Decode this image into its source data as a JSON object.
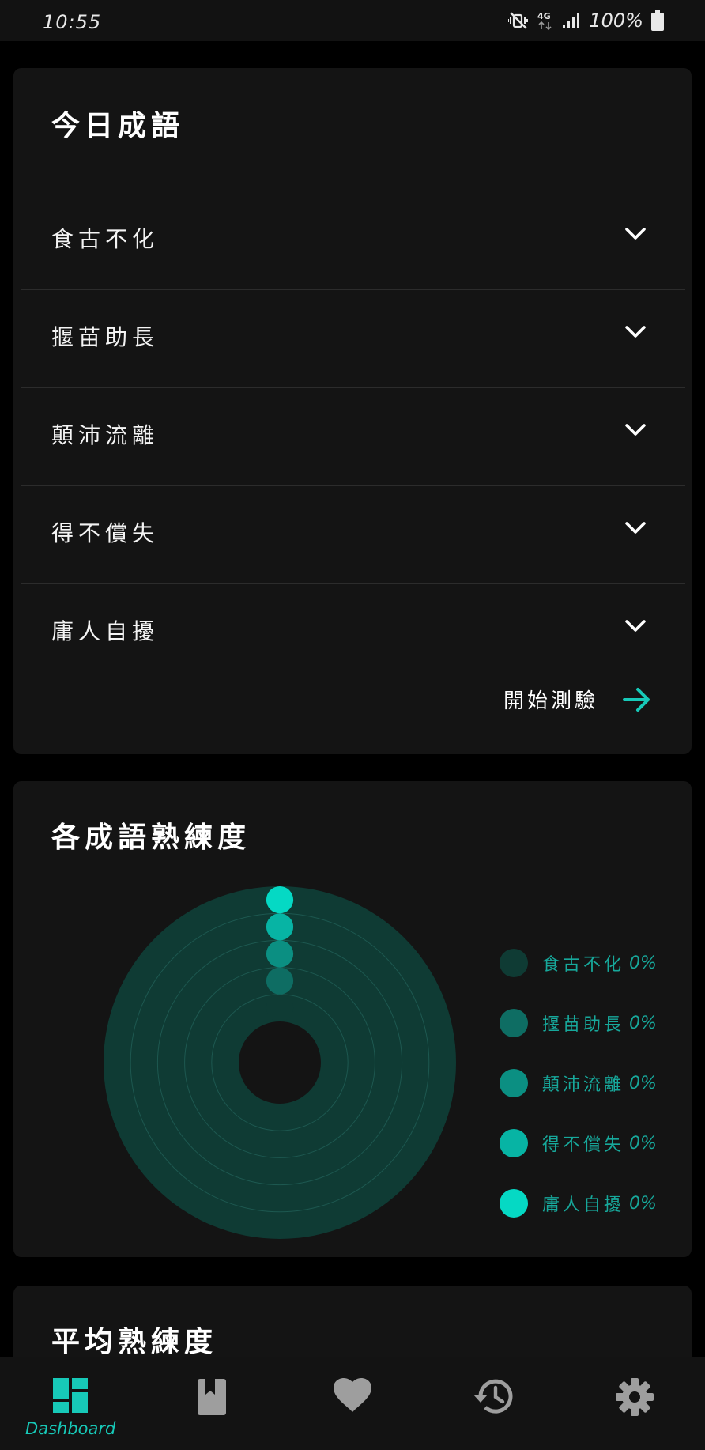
{
  "status_bar": {
    "time": "10:55",
    "network": "4G",
    "battery": "100%",
    "icons": [
      "mute-vibrate-icon",
      "network-4g-icon",
      "signal-icon",
      "battery-icon"
    ]
  },
  "today_card": {
    "title": "今日成語",
    "idioms": [
      {
        "label": "食古不化",
        "icon": "chevron-down-icon"
      },
      {
        "label": "揠苗助長",
        "icon": "chevron-down-icon"
      },
      {
        "label": "顛沛流離",
        "icon": "chevron-down-icon"
      },
      {
        "label": "得不償失",
        "icon": "chevron-down-icon"
      },
      {
        "label": "庸人自擾",
        "icon": "chevron-down-icon"
      }
    ],
    "quiz_label": "開始測驗",
    "quiz_icon": "arrow-right-icon"
  },
  "proficiency_card": {
    "title": "各成語熟練度",
    "chart_data": {
      "type": "radial-progress",
      "series": [
        {
          "name": "食古不化",
          "value": 0,
          "unit": "%",
          "color": "#0f3b34"
        },
        {
          "name": "揠苗助長",
          "value": 0,
          "unit": "%",
          "color": "#0e6d63"
        },
        {
          "name": "顛沛流離",
          "value": 0,
          "unit": "%",
          "color": "#0b8f82"
        },
        {
          "name": "得不償失",
          "value": 0,
          "unit": "%",
          "color": "#07b4a4"
        },
        {
          "name": "庸人自擾",
          "value": 0,
          "unit": "%",
          "color": "#05d9c4"
        }
      ],
      "track_color": "#0f3b34",
      "value_labels": [
        "0%",
        "0%",
        "0%",
        "0%",
        "0%"
      ]
    }
  },
  "average_card": {
    "title": "平均熟練度"
  },
  "bottom_nav": {
    "items": [
      {
        "label": "Dashboard",
        "icon": "dashboard-icon",
        "active": true
      },
      {
        "label": "",
        "icon": "book-icon",
        "active": false
      },
      {
        "label": "",
        "icon": "heart-icon",
        "active": false
      },
      {
        "label": "",
        "icon": "history-icon",
        "active": false
      },
      {
        "label": "",
        "icon": "settings-icon",
        "active": false
      }
    ]
  },
  "colors": {
    "accent": "#17c9b8",
    "card_bg": "#141414",
    "page_bg": "#000000",
    "divider": "#2c2c2c"
  }
}
